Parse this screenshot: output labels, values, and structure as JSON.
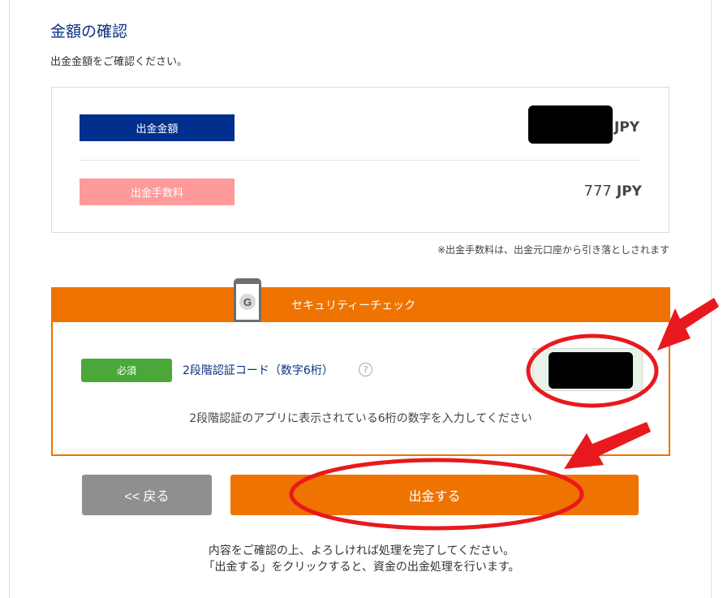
{
  "page": {
    "title": "金額の確認",
    "subtitle": "出金金額をご確認ください。"
  },
  "amount": {
    "amount_label": "出金金額",
    "amount_unit": "JPY",
    "fee_label": "出金手数料",
    "fee_value": "777",
    "fee_unit": "JPY",
    "fee_note": "※出金手数料は、出金元口座から引き落としされます"
  },
  "security": {
    "header": "セキュリティーチェック",
    "phone_icon_letter": "G",
    "required_badge": "必須",
    "code_label": "2段階認証コード（数字6桁）",
    "help_icon_char": "?",
    "note": "2段階認証のアプリに表示されている6桁の数字を入力してください"
  },
  "buttons": {
    "back": "<< 戻る",
    "withdraw": "出金する"
  },
  "footer": {
    "line1": "内容をご確認の上、よろしければ処理を完了してください。",
    "line2": "「出金する」をクリックすると、資金の出金処理を行います。"
  },
  "colors": {
    "brand_navy": "#002f8e",
    "fee_pink": "#ff9a9a",
    "accent_orange": "#ef7300",
    "required_green": "#4aa83a",
    "back_gray": "#8f8f8f",
    "annotation_red": "#e8191d"
  }
}
